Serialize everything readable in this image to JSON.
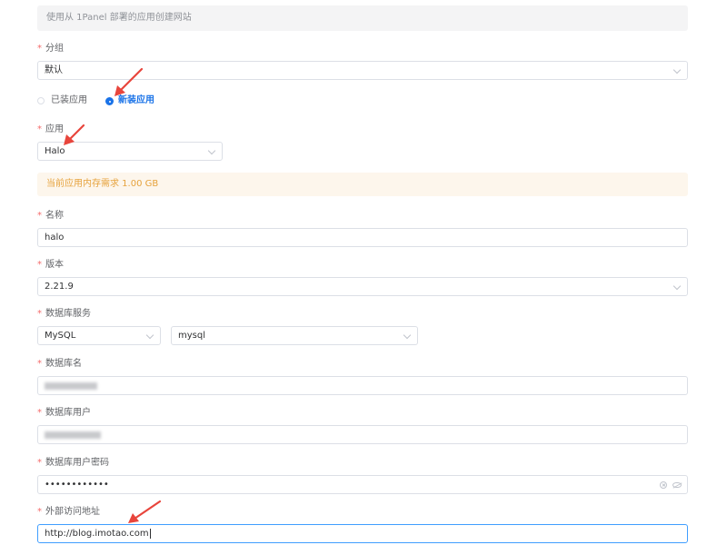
{
  "banner": {
    "info": "使用从 1Panel 部署的应用创建网站",
    "memory_warning": "当前应用内存需求 1.00 GB"
  },
  "required_mark": "*",
  "group": {
    "label": "分组",
    "value": "默认"
  },
  "source": {
    "options": [
      "已装应用",
      "新装应用"
    ],
    "selected": "新装应用"
  },
  "app": {
    "label": "应用",
    "value": "Halo"
  },
  "name": {
    "label": "名称",
    "value": "halo"
  },
  "version": {
    "label": "版本",
    "value": "2.21.9"
  },
  "db_service": {
    "label": "数据库服务",
    "type": "MySQL",
    "instance": "mysql"
  },
  "db_name": {
    "label": "数据库名",
    "value": ""
  },
  "db_user": {
    "label": "数据库用户",
    "value": ""
  },
  "db_password": {
    "label": "数据库用户密码",
    "value": "••••••••••••"
  },
  "external_url": {
    "label": "外部访问地址",
    "value": "http://blog.imotao.com"
  },
  "colors": {
    "accent": "#1a73e8",
    "required": "#f56c6c",
    "warning_text": "#e6a23c",
    "warning_bg": "#fdf6ec",
    "focus_border": "#409eff",
    "annotation_arrow": "#e8453c"
  }
}
